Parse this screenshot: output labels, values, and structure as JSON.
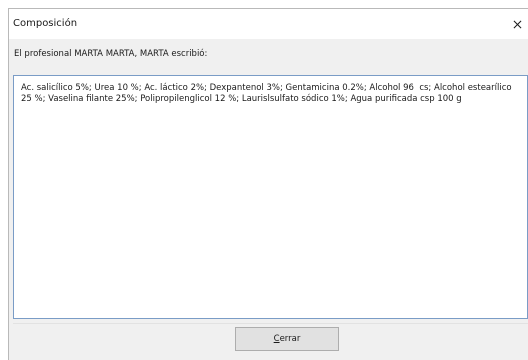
{
  "window": {
    "title": "Composición",
    "close_glyph": "✕"
  },
  "header": {
    "text": "El profesional MARTA MARTA, MARTA escribió:"
  },
  "composition": {
    "text": "Ac. salicílico 5%; Urea 10 %; Ac. láctico 2%; Dexpantenol 3%; Gentamicina 0.2%; Alcohol 96  cs; Alcohol estearílico 25 %; Vaselina filante 25%; Polipropilenglicol 12 %; Laurislsulfato sódico 1%; Agua purificada csp 100 g"
  },
  "footer": {
    "close_button": {
      "mnemonic": "C",
      "label_rest": "errar"
    }
  },
  "icons": {
    "close": "close-icon"
  }
}
